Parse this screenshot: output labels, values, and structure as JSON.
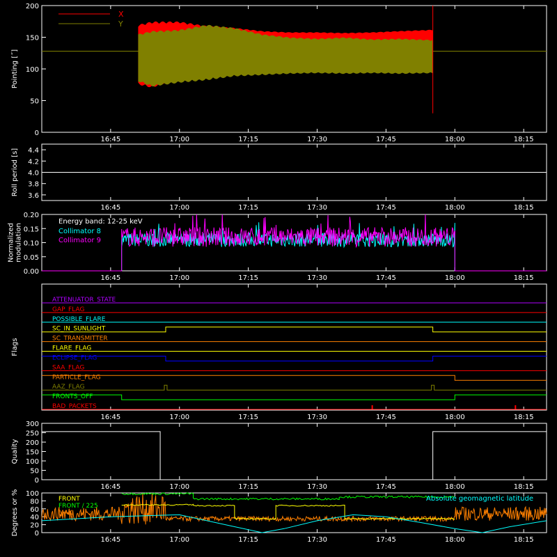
{
  "chart_data": [
    {
      "panel": "pointing",
      "type": "area",
      "ylabel": "Pointing [˝]",
      "ylim": [
        0,
        200
      ],
      "yticks": [
        "0",
        "50",
        "100",
        "150",
        "200"
      ],
      "xlim_min": [
        16.5,
        18.333
      ],
      "xticks": [
        "16:45",
        "17:00",
        "17:15",
        "17:30",
        "17:45",
        "18:00",
        "18:15"
      ],
      "legend_placement": "top-left",
      "reference_level": 128,
      "series": [
        {
          "name": "X",
          "color": "#ff0000",
          "t": [
            16.85,
            16.9,
            17.0,
            17.1,
            17.2,
            17.3,
            17.4,
            17.5,
            17.6,
            17.7,
            17.8,
            17.92
          ],
          "high": [
            170,
            175,
            175,
            168,
            165,
            160,
            158,
            158,
            157,
            158,
            160,
            162
          ],
          "low": [
            75,
            70,
            85,
            95,
            110,
            118,
            122,
            123,
            123,
            124,
            125,
            125
          ]
        },
        {
          "name": "Y",
          "color": "#808000",
          "t": [
            16.85,
            16.9,
            17.0,
            17.1,
            17.2,
            17.3,
            17.4,
            17.5,
            17.6,
            17.7,
            17.8,
            17.92
          ],
          "high": [
            155,
            160,
            162,
            170,
            165,
            155,
            150,
            148,
            150,
            147,
            148,
            146
          ],
          "low": [
            80,
            72,
            78,
            82,
            88,
            90,
            92,
            93,
            92,
            93,
            92,
            93
          ]
        }
      ],
      "markers": [
        {
          "t": 17.92,
          "from": 30,
          "to": 200,
          "color": "#ff0000"
        }
      ]
    },
    {
      "panel": "roll",
      "type": "line",
      "ylabel": "Roll period [s]",
      "ylim": [
        3.5,
        4.5
      ],
      "yticks": [
        "3.6",
        "3.8",
        "4.0",
        "4.2",
        "4.4"
      ],
      "series": [
        {
          "name": "",
          "color": "#ffffff",
          "t": [
            16.5,
            18.333
          ],
          "values": [
            4.0,
            4.0
          ]
        }
      ]
    },
    {
      "panel": "modulation",
      "type": "line",
      "ylabel": "Normalized modulation",
      "ylim": [
        0,
        0.2
      ],
      "yticks": [
        "0.00",
        "0.05",
        "0.10",
        "0.15",
        "0.20"
      ],
      "annotation": "Energy band: 12-25 keV",
      "series": [
        {
          "name": "Collimator 8",
          "color": "#00ffff",
          "t_start": 16.79,
          "t_end": 18.0,
          "mean": 0.11,
          "spread": 0.025
        },
        {
          "name": "Collimator 9",
          "color": "#ff00ff",
          "t_start": 16.79,
          "t_end": 18.0,
          "mean": 0.12,
          "spread": 0.035
        }
      ]
    },
    {
      "panel": "flags",
      "type": "line",
      "ylabel": "Flags",
      "series": [
        {
          "name": "ATTENUATOR_STATE",
          "color": "#b000ff",
          "segments": [
            [
              16.5,
              0
            ],
            [
              18.333,
              0
            ]
          ]
        },
        {
          "name": "GAP_FLAG",
          "color": "#ff0000",
          "segments": [
            [
              16.5,
              0
            ],
            [
              18.333,
              0
            ]
          ]
        },
        {
          "name": "POSSIBLE_FLARE",
          "color": "#00ffff",
          "segments": [
            [
              16.5,
              0
            ],
            [
              18.333,
              0
            ]
          ]
        },
        {
          "name": "SC_IN_SUNLIGHT",
          "color": "#ffff00",
          "segments": [
            [
              16.5,
              0
            ],
            [
              16.95,
              0
            ],
            [
              16.95,
              1
            ],
            [
              17.92,
              1
            ],
            [
              17.92,
              0
            ],
            [
              18.333,
              0
            ]
          ]
        },
        {
          "name": "SC_TRANSMITTER",
          "color": "#ff8000",
          "segments": [
            [
              16.5,
              0
            ],
            [
              18.333,
              0
            ]
          ]
        },
        {
          "name": "FLARE_FLAG",
          "color": "#ffff00",
          "segments": [
            [
              16.5,
              0
            ],
            [
              18.333,
              0
            ]
          ]
        },
        {
          "name": "ECLIPSE_FLAG",
          "color": "#0000ff",
          "segments": [
            [
              16.5,
              1
            ],
            [
              16.95,
              1
            ],
            [
              16.95,
              0
            ],
            [
              17.92,
              0
            ],
            [
              17.92,
              1
            ],
            [
              18.333,
              1
            ]
          ]
        },
        {
          "name": "SAA_FLAG",
          "color": "#ff0000",
          "segments": [
            [
              16.5,
              0
            ],
            [
              18.333,
              0
            ]
          ]
        },
        {
          "name": "PARTICLE_FLAG",
          "color": "#ff8000",
          "segments": [
            [
              16.5,
              1
            ],
            [
              16.8,
              1
            ],
            [
              16.8,
              1
            ],
            [
              18.0,
              1
            ],
            [
              18.0,
              0
            ],
            [
              18.333,
              0
            ]
          ]
        },
        {
          "name": "AAZ_FLAG",
          "color": "#808000",
          "segments": [
            [
              16.5,
              0
            ],
            [
              16.945,
              0
            ],
            [
              16.945,
              1
            ],
            [
              16.955,
              1
            ],
            [
              16.955,
              0
            ],
            [
              17.915,
              0
            ],
            [
              17.915,
              1
            ],
            [
              17.925,
              1
            ],
            [
              17.925,
              0
            ],
            [
              18.333,
              0
            ]
          ]
        },
        {
          "name": "FRONTS_OFF",
          "color": "#00ff00",
          "segments": [
            [
              16.5,
              1
            ],
            [
              16.79,
              1
            ],
            [
              16.79,
              0
            ],
            [
              18.0,
              0
            ],
            [
              18.0,
              1
            ],
            [
              18.333,
              1
            ]
          ]
        },
        {
          "name": "BAD_PACKETS",
          "color": "#ff0000",
          "segments": [
            [
              16.5,
              0
            ],
            [
              18.333,
              0
            ]
          ],
          "spikes": [
            17.7,
            18.22
          ]
        }
      ]
    },
    {
      "panel": "quality",
      "type": "line",
      "ylabel": "Quality",
      "ylim": [
        0,
        300
      ],
      "yticks": [
        "0",
        "50",
        "100",
        "150",
        "200",
        "250",
        "300"
      ],
      "series": [
        {
          "name": "",
          "color": "#ffffff",
          "t": [
            16.5,
            16.93,
            16.93,
            17.92,
            17.92,
            18.333
          ],
          "values": [
            256,
            256,
            0,
            0,
            256,
            256
          ]
        }
      ]
    },
    {
      "panel": "rates",
      "type": "line",
      "ylabel": "Degrees or %",
      "ylim": [
        0,
        100
      ],
      "yticks": [
        "0",
        "20",
        "40",
        "60",
        "80",
        "100"
      ],
      "series": [
        {
          "name": "FRONT",
          "color": "#ffff00"
        },
        {
          "name": "FRONT / 225",
          "color": "#00ff00"
        },
        {
          "name": "MAX",
          "color": "#ff8000"
        },
        {
          "name": "Absolute geomagnetic latitude",
          "color": "#00ffff",
          "t": [
            16.5,
            16.75,
            17.0,
            17.1,
            17.2,
            17.3,
            17.38,
            17.5,
            17.63,
            17.75,
            17.88,
            18.0,
            18.1,
            18.2,
            18.333
          ],
          "values": [
            30,
            40,
            45,
            30,
            15,
            0,
            10,
            30,
            45,
            40,
            25,
            10,
            0,
            15,
            30
          ]
        }
      ],
      "bands": {
        "green": {
          "t": [
            16.79,
            17.05,
            17.05,
            17.58,
            17.58,
            18.0
          ],
          "values": [
            98,
            98,
            85,
            85,
            90,
            90
          ]
        },
        "yellow": {
          "t": [
            16.79,
            17.05,
            17.05,
            17.2,
            17.2,
            17.35,
            17.35,
            17.6,
            17.6,
            18.0
          ],
          "values": [
            70,
            70,
            68,
            68,
            35,
            35,
            68,
            68,
            35,
            35
          ]
        },
        "orange_mean": 35
      }
    }
  ]
}
